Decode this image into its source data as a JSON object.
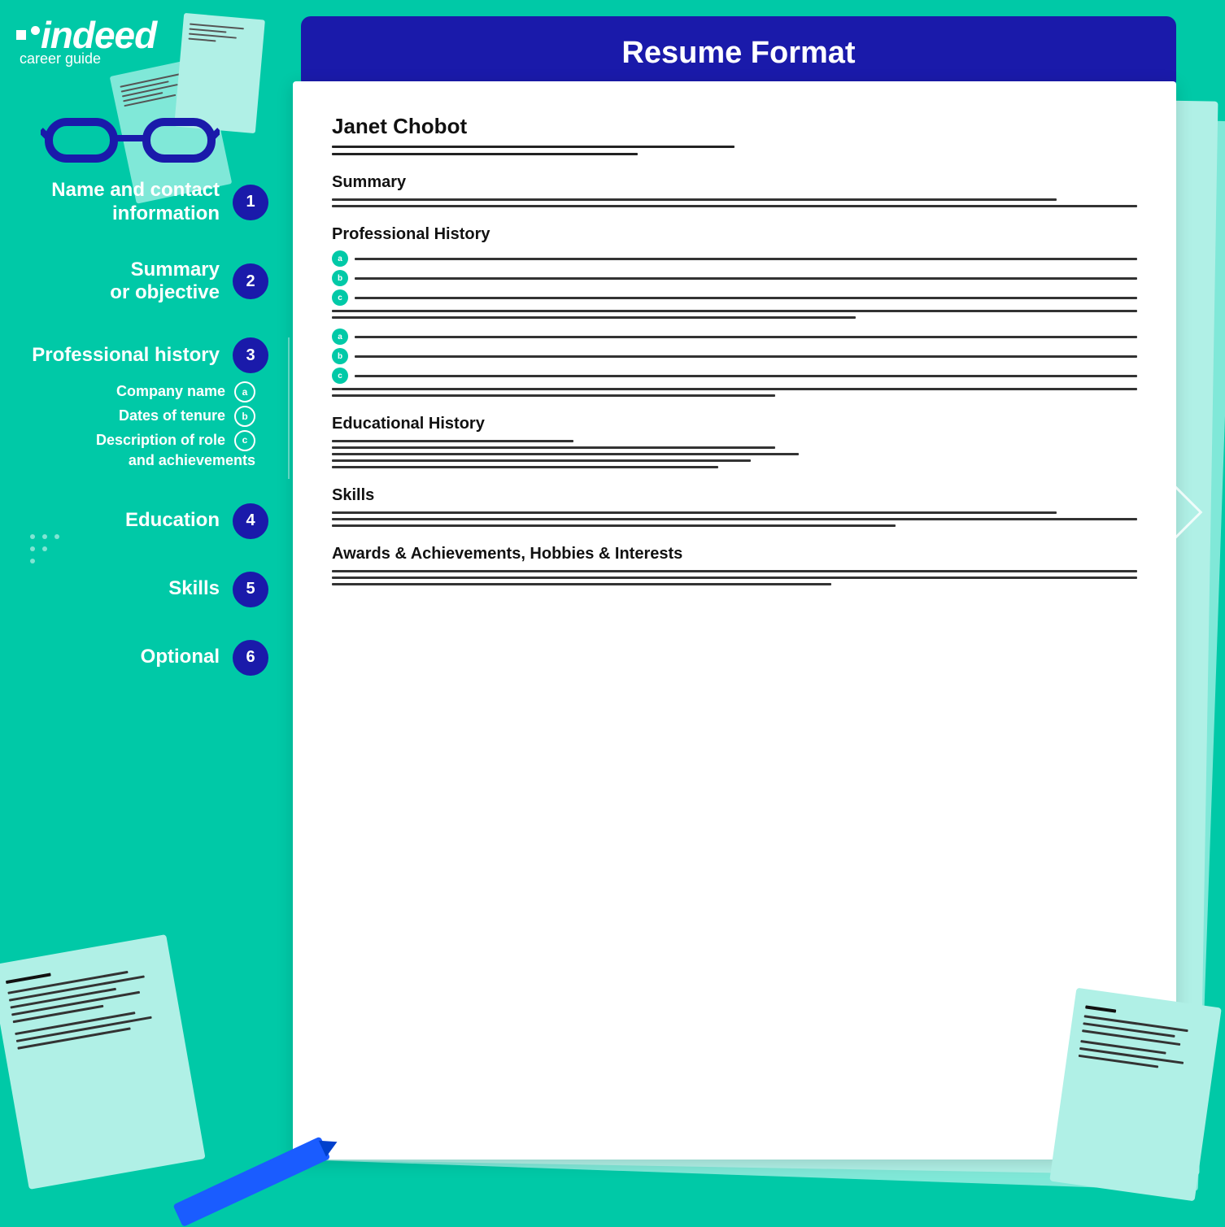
{
  "header": {
    "title": "Resume Format",
    "background_color": "#1a1aaa"
  },
  "logo": {
    "name": "indeed",
    "subtitle": "career guide"
  },
  "sidebar": {
    "items": [
      {
        "id": 1,
        "label": "Name and contact information",
        "number": "1"
      },
      {
        "id": 2,
        "label": "Summary\nor objective",
        "number": "2"
      },
      {
        "id": 3,
        "label": "Professional history",
        "number": "3",
        "subitems": [
          {
            "label": "Company name",
            "badge": "a"
          },
          {
            "label": "Dates of tenure",
            "badge": "b"
          },
          {
            "label": "Description of role\nand achievements",
            "badge": "c"
          }
        ]
      },
      {
        "id": 4,
        "label": "Education",
        "number": "4"
      },
      {
        "id": 5,
        "label": "Skills",
        "number": "5"
      },
      {
        "id": 6,
        "label": "Optional",
        "number": "6"
      }
    ]
  },
  "resume": {
    "name": "Janet Chobot",
    "sections": [
      {
        "title": "Summary"
      },
      {
        "title": "Professional History"
      },
      {
        "title": "Educational History"
      },
      {
        "title": "Skills"
      },
      {
        "title": "Awards & Achievements, Hobbies & Interests"
      }
    ]
  }
}
